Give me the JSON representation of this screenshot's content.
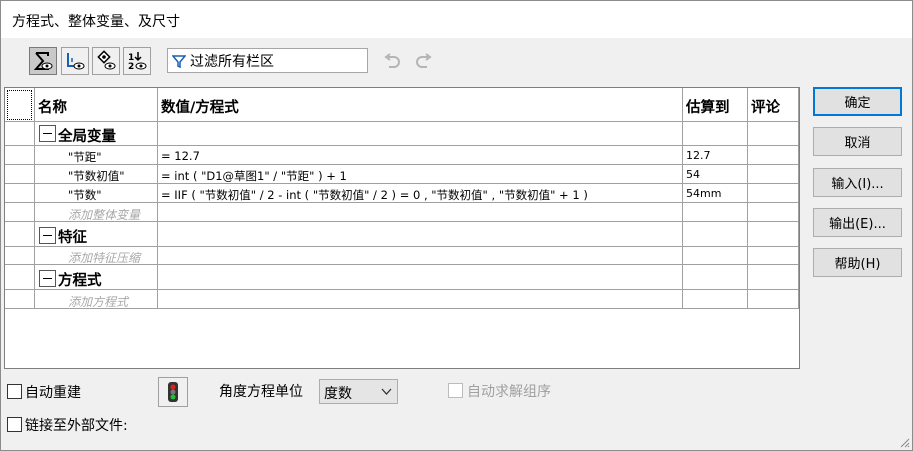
{
  "window": {
    "title": "方程式、整体变量、及尺寸"
  },
  "toolbar": {
    "buttons": [
      {
        "icon": "sigma-icon",
        "active": true
      },
      {
        "icon": "dimension-view-icon",
        "active": false
      },
      {
        "icon": "dimension-visibility-icon",
        "active": false
      },
      {
        "icon": "ordered-view-icon",
        "active": false
      }
    ],
    "filter_value": "过滤所有栏区",
    "undo_icon": "undo-icon",
    "redo_icon": "redo-icon"
  },
  "grid": {
    "headers": {
      "name": "名称",
      "value": "数值/方程式",
      "eval": "估算到",
      "comment": "评论"
    },
    "groups": {
      "globals": {
        "label": "全局变量",
        "rows": [
          {
            "name": "\"节距\"",
            "value": "= 12.7",
            "eval": "12.7"
          },
          {
            "name": "\"节数初值\"",
            "value": "= int ( \"D1@草图1\" / \"节距\" ) + 1",
            "eval": "54"
          },
          {
            "name": "\"节数\"",
            "value": "= IIF ( \"节数初值\" / 2 - int ( \"节数初值\" / 2 ) = 0 , \"节数初值\" , \"节数初值\" + 1 )",
            "eval": "54mm"
          }
        ],
        "placeholder": "添加整体变量"
      },
      "features": {
        "label": "特征",
        "placeholder": "添加特征压缩"
      },
      "equations": {
        "label": "方程式",
        "placeholder": "添加方程式"
      }
    }
  },
  "buttons": {
    "ok": "确定",
    "cancel": "取消",
    "import": "输入(I)...",
    "export": "输出(E)...",
    "help": "帮助(H)"
  },
  "bottom": {
    "auto_rebuild": "自动重建",
    "auto_rebuild_checked": false,
    "angle_unit_label": "角度方程单位",
    "angle_unit_value": "度数",
    "auto_solve_order": "自动求解组序",
    "auto_solve_order_checked": false,
    "link_external": "链接至外部文件:",
    "link_external_checked": false
  }
}
